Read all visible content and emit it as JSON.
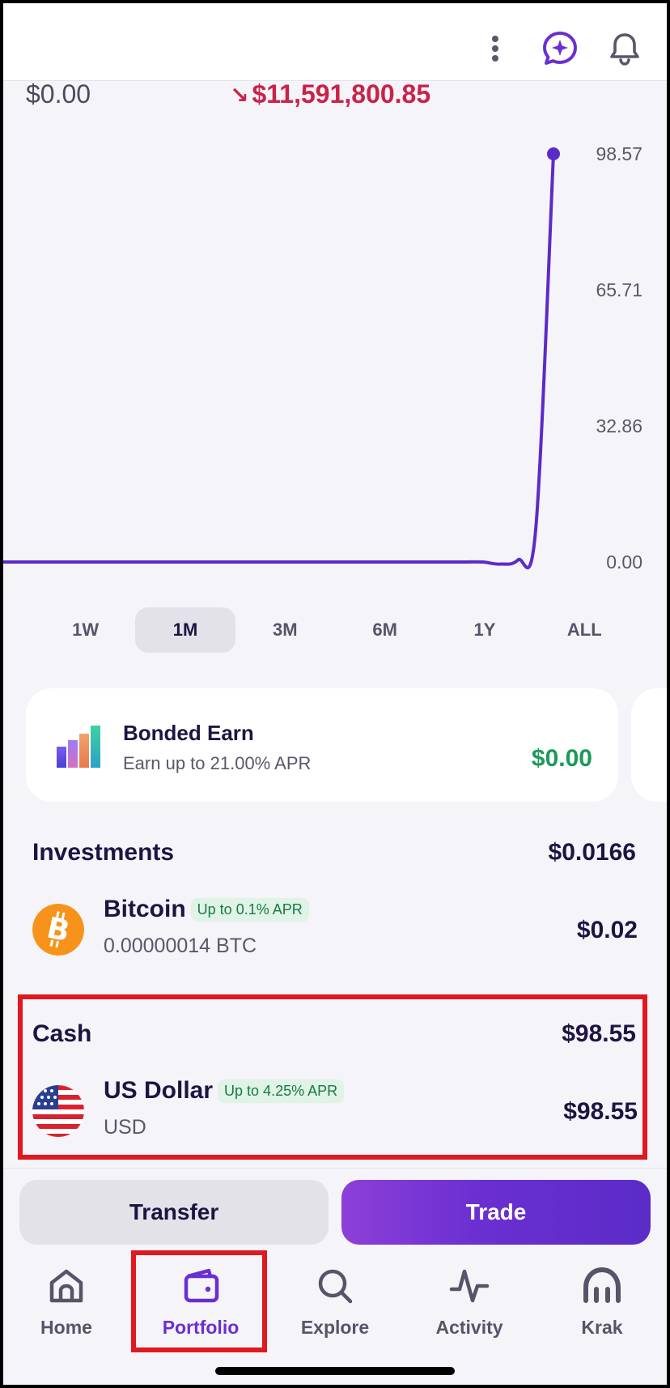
{
  "header": {
    "icons": [
      "more-vertical-icon",
      "ai-assistant-icon",
      "bell-icon"
    ],
    "accent_color": "#6a2fd1"
  },
  "summary": {
    "balance_start": "$0.00",
    "change": "$11,591,800.85",
    "change_color": "#c8234a"
  },
  "chart_data": {
    "type": "line",
    "y_ticks": [
      "98.57",
      "65.71",
      "32.86",
      "0.00"
    ],
    "ylim": [
      0,
      98.57
    ],
    "series": [
      {
        "values": [
          0,
          0,
          0,
          0,
          0,
          0,
          0,
          0,
          0,
          0,
          0,
          0,
          0,
          0,
          0,
          0,
          0,
          0,
          0,
          0,
          0,
          0,
          0,
          0,
          0,
          0,
          0,
          0,
          -0.5,
          0.5,
          8,
          98.57
        ]
      }
    ],
    "line_color": "#5b2bc8",
    "grid": false
  },
  "ranges": {
    "items": [
      "1W",
      "1M",
      "3M",
      "6M",
      "1Y",
      "ALL"
    ],
    "selected": "1M"
  },
  "earn": {
    "title": "Bonded Earn",
    "subtitle": "Earn up to 21.00% APR",
    "value": "$0.00"
  },
  "investments": {
    "title": "Investments",
    "total": "$0.0166",
    "items": [
      {
        "name": "Bitcoin",
        "badge": "Up to 0.1% APR",
        "amount": "0.00000014 BTC",
        "value": "$0.02",
        "icon": "bitcoin-icon"
      }
    ]
  },
  "cash": {
    "title": "Cash",
    "total": "$98.55",
    "items": [
      {
        "name": "US Dollar",
        "badge": "Up to 4.25% APR",
        "amount": "USD",
        "value": "$98.55",
        "icon": "us-flag-icon"
      }
    ]
  },
  "actions": {
    "transfer_label": "Transfer",
    "trade_label": "Trade"
  },
  "nav": {
    "items": [
      {
        "label": "Home",
        "icon": "home-icon"
      },
      {
        "label": "Portfolio",
        "icon": "wallet-icon"
      },
      {
        "label": "Explore",
        "icon": "search-icon"
      },
      {
        "label": "Activity",
        "icon": "activity-icon"
      },
      {
        "label": "Krak",
        "icon": "krak-icon"
      }
    ],
    "active": "Portfolio"
  }
}
